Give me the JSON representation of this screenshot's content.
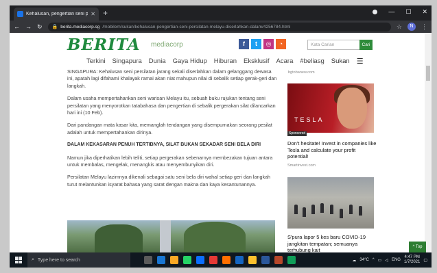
{
  "browser": {
    "tab_title": "Kehalusan, pengertian seni persi",
    "tab_close": "✕",
    "new_tab": "+",
    "url_host": "berita.mediacorp.sg",
    "url_path": "/mobilem/sukan/kehalusan-pengertian-seni-persilatan-melayu-diserlahkan-dalam/4256784.html",
    "profile_initial": "N"
  },
  "site": {
    "logo": "BERITA",
    "logo_sub": "mediacorp",
    "social": [
      "f",
      "t",
      "ig",
      "rss"
    ],
    "search_placeholder": "Kata Carian",
    "search_button": "Cari",
    "nav": [
      "Terkini",
      "Singapura",
      "Dunia",
      "Gaya Hidup",
      "Hiburan",
      "Eksklusif",
      "Acara",
      "#beliasg",
      "Sukan"
    ]
  },
  "article": {
    "p1": "SINGAPURA: Kehalusan seni persilatan jarang sekali diserlahkan dalam gelanggang dewasa ini, apatah lagi difahami khalayak ramai akan niat mahupun nilai di sebalik setiap gerak-geri dan langkah.",
    "p2": "Dalam usaha mempertahankan seni warisan Melayu itu, sebuah buku rujukan tentang seni persilatan yang menyorotkan tatabahasa dan pengertian di sebalik pergerakan silat dilancarkan hari ini (10 Feb).",
    "p3": "Dari pandangan mata kasar kita, memanglah tendangan yang disempurnakan seorang pesilat adalah untuk mempertahankan dirinya.",
    "heading": "DALAM KEKASARAN PENUH TERTIBNYA, SILAT BUKAN SEKADAR SENI BELA DIRI",
    "p4": "Namun jika diperhatikan lebih teliti, setiap pergerakan sebenarnya membezakan tujuan antara untuk membalas, mengelak, menangkis atau menyembunyikan diri.",
    "p5": "Persilatan Melayu lazimnya dikenali sebagai satu seni bela diri wahal setiap geri dan langkah turut melantunkan isyarat bahasa yang sarat dengan makna dan kaya kesantunannya."
  },
  "sidebar": {
    "source1": "bgtobanew.com",
    "ad1_brand": "TESLA",
    "sponsored": "Sponsored",
    "ad1_caption": "Don't hesitate! Invest in companies like Tesla and calculate your profit potential!",
    "ad1_source": "Smartinvest.com",
    "ad2_caption": "S'pura lapor 5 kes baru COVID-19 jangkitan tempatan; semuanya terhubung kait"
  },
  "top_button": "Top",
  "taskbar": {
    "search_placeholder": "Type here to search",
    "temp": "34°C",
    "lang": "ENG",
    "time": "4:47 PM",
    "date": "1/7/2021"
  }
}
